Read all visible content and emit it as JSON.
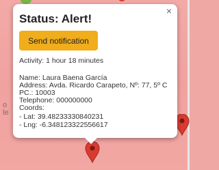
{
  "popup": {
    "title": "Status: Alert!",
    "send_button": "Send notification",
    "close_symbol": "×",
    "activity": "Activity: 1 hour 18 minutes",
    "name": "Name: Laura Baena García",
    "address": "Address: Avda. Ricardo Carapeto, Nº: 77, 5º C",
    "postal_code": "PC.: 10003",
    "telephone": "Telephone: 000000000",
    "coords_label": "Coords:",
    "lat": "- Lat: 39.48233330840231",
    "lng": "- Lng: -6.348123322556617"
  },
  "map": {
    "label_line1": "o",
    "label_line2": "le"
  },
  "colors": {
    "map_fill": "#f0a8a4",
    "button": "#f0ad1c",
    "pin": "#d93b30"
  },
  "icons": [
    "map-pin-icon",
    "close-icon"
  ]
}
